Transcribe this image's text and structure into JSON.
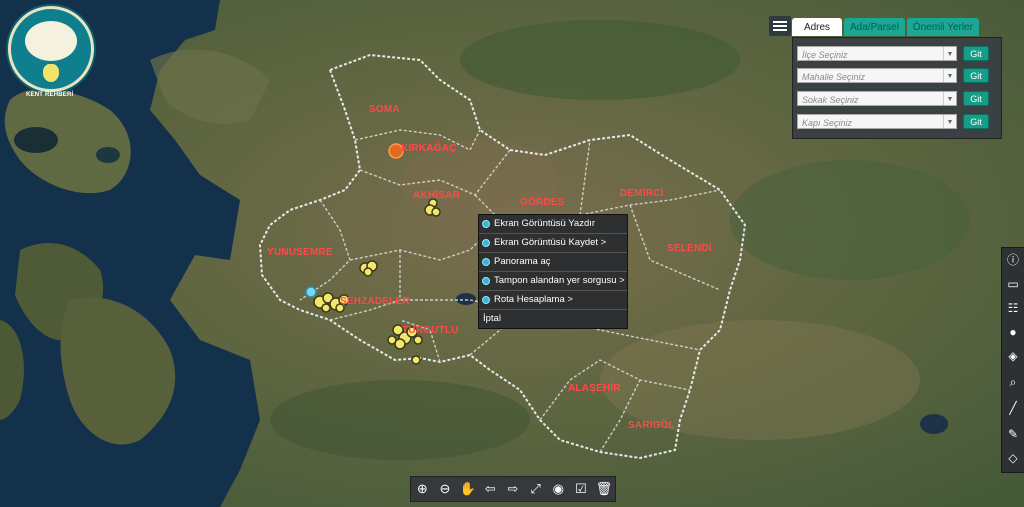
{
  "logo": {
    "text": "KENT REHBERİ"
  },
  "map": {
    "districts": [
      {
        "name": "SOMA"
      },
      {
        "name": "KIRKAĞAÇ"
      },
      {
        "name": "AKHİSAR"
      },
      {
        "name": "GÖRDES"
      },
      {
        "name": "DEMİRCİ"
      },
      {
        "name": "SELENDİ"
      },
      {
        "name": "YUNUSEMRE"
      },
      {
        "name": "ŞEHZADELER"
      },
      {
        "name": "TURGUTLU"
      },
      {
        "name": "ALAŞEHİR"
      },
      {
        "name": "SARIGÖL"
      }
    ]
  },
  "search_panel": {
    "tabs": [
      "Adres",
      "Ada/Parsel",
      "Önemli Yerler"
    ],
    "rows": [
      {
        "placeholder": "İlçe Seçiniz",
        "button": "Git"
      },
      {
        "placeholder": "Mahalle Seçiniz",
        "button": "Git"
      },
      {
        "placeholder": "Sokak Seçiniz",
        "button": "Git"
      },
      {
        "placeholder": "Kapı Seçiniz",
        "button": "Git"
      }
    ]
  },
  "context_menu": {
    "items": [
      "Ekran Görüntüsü Yazdır",
      "Ekran Görüntüsü Kaydet >",
      "Panorama aç",
      "Tampon alandan yer sorgusu >",
      "Rota Hesaplama >"
    ],
    "cancel": "İptal"
  },
  "bottom_toolbar": {
    "icons": [
      "zoom-in-icon",
      "zoom-out-icon",
      "pan-hand-icon",
      "back-icon",
      "forward-icon",
      "full-extent-icon",
      "street-view-icon",
      "select-icon",
      "trash-icon"
    ]
  },
  "right_toolbar": {
    "icons": [
      "info-icon",
      "map-icon",
      "legend-icon",
      "location-pin-icon",
      "layers-icon",
      "search-icon",
      "measure-icon",
      "draw-icon",
      "basemap-icon"
    ]
  },
  "colors": {
    "district_label": "#ff4a4a",
    "accent": "#169d88",
    "panel_bg": "#3b4042",
    "menu_bg": "#2e2f30"
  }
}
